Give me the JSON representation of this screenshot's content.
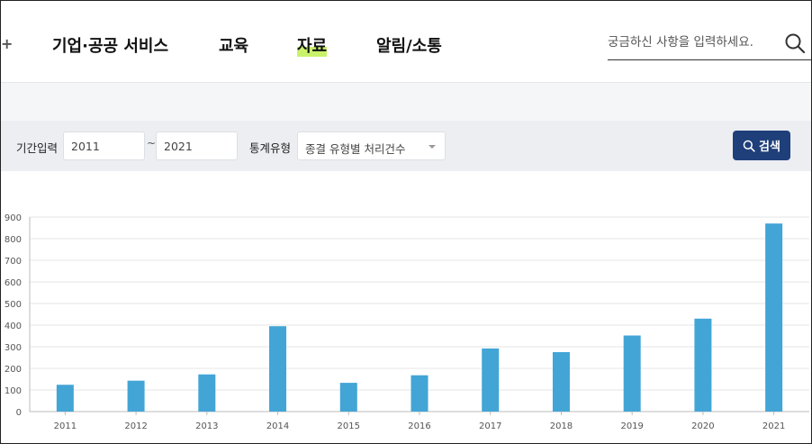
{
  "header": {
    "nav_edge": "+",
    "nav": [
      {
        "label": "기업·공공 서비스"
      },
      {
        "label": "교육"
      },
      {
        "label": "자료"
      },
      {
        "label": "알림/소통"
      }
    ],
    "active_nav": "자료",
    "search": {
      "placeholder": "궁금하신 사항을 입력하세요.",
      "icon": "search-icon"
    }
  },
  "filter": {
    "period_label": "기간입력",
    "start_year": "2011",
    "tilde": "~",
    "end_year": "2021",
    "stat_type_label": "통계유형",
    "stat_type_value": "종결 유형별 처리건수",
    "search_button": "검색"
  },
  "colors": {
    "bar": "#42a5d6",
    "button": "#1f3f7a",
    "highlight": "#c9f26a"
  },
  "chart_data": {
    "type": "bar",
    "title": "",
    "xlabel": "",
    "ylabel": "",
    "categories": [
      "2011",
      "2012",
      "2013",
      "2014",
      "2015",
      "2016",
      "2017",
      "2018",
      "2019",
      "2020",
      "2021"
    ],
    "values": [
      124,
      143,
      172,
      395,
      133,
      168,
      292,
      275,
      352,
      430,
      870
    ],
    "ylim": [
      0,
      900
    ],
    "yticks": [
      0,
      100,
      200,
      300,
      400,
      500,
      600,
      700,
      800,
      900
    ],
    "grid": true,
    "legend": "none"
  }
}
